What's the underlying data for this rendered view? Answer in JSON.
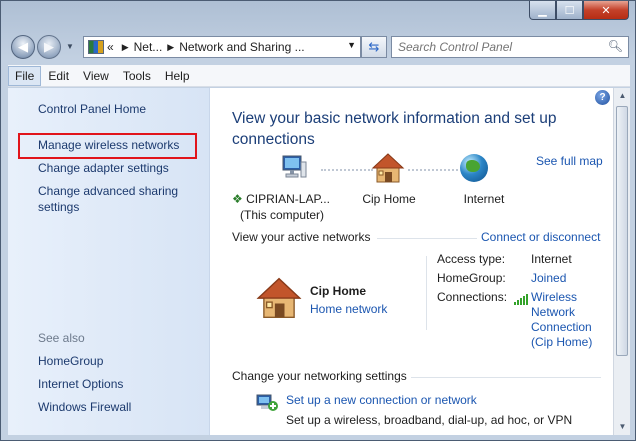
{
  "window": {
    "min_glyph": "▁",
    "max_glyph": "☐",
    "close_glyph": "✕"
  },
  "address": {
    "overflow_glyph": "«",
    "crumbs": [
      "Net...",
      "Network and Sharing ..."
    ],
    "sep_glyph": "▶",
    "dropdown_glyph": "▼"
  },
  "search": {
    "placeholder": "Search Control Panel",
    "icon": "search-icon"
  },
  "menu": {
    "items": [
      "File",
      "Edit",
      "View",
      "Tools",
      "Help"
    ]
  },
  "sidebar": {
    "home": "Control Panel Home",
    "links": [
      "Manage wireless networks",
      "Change adapter settings",
      "Change advanced sharing settings"
    ],
    "see_also_heading": "See also",
    "see_also": [
      "HomeGroup",
      "Internet Options",
      "Windows Firewall"
    ],
    "highlight_color": "#e1141b"
  },
  "main": {
    "help_glyph": "?",
    "title": "View your basic network information and set up connections",
    "see_full_map": "See full map",
    "map": {
      "computer_name": "CIPRIAN-LAP...",
      "computer_sub": "(This computer)",
      "home_label": "Cip Home",
      "internet_label": "Internet"
    },
    "active_networks_heading": "View your active networks",
    "connect_disconnect": "Connect or disconnect",
    "network": {
      "name": "Cip Home",
      "type": "Home network",
      "access_type_label": "Access type:",
      "access_type_value": "Internet",
      "homegroup_label": "HomeGroup:",
      "homegroup_value": "Joined",
      "connections_label": "Connections:",
      "connections_value": [
        "Wireless",
        "Network",
        "Connection",
        "(Cip Home)"
      ]
    },
    "change_settings_heading": "Change your networking settings",
    "setup_link": "Set up a new connection or network",
    "setup_desc": "Set up a wireless, broadband, dial-up, ad hoc, or VPN"
  },
  "scroll": {
    "up_glyph": "▲",
    "down_glyph": "▼"
  },
  "colors": {
    "link": "#1b56b0",
    "title": "#1b3e78",
    "sidebar_bg": "#e8f0fb"
  }
}
